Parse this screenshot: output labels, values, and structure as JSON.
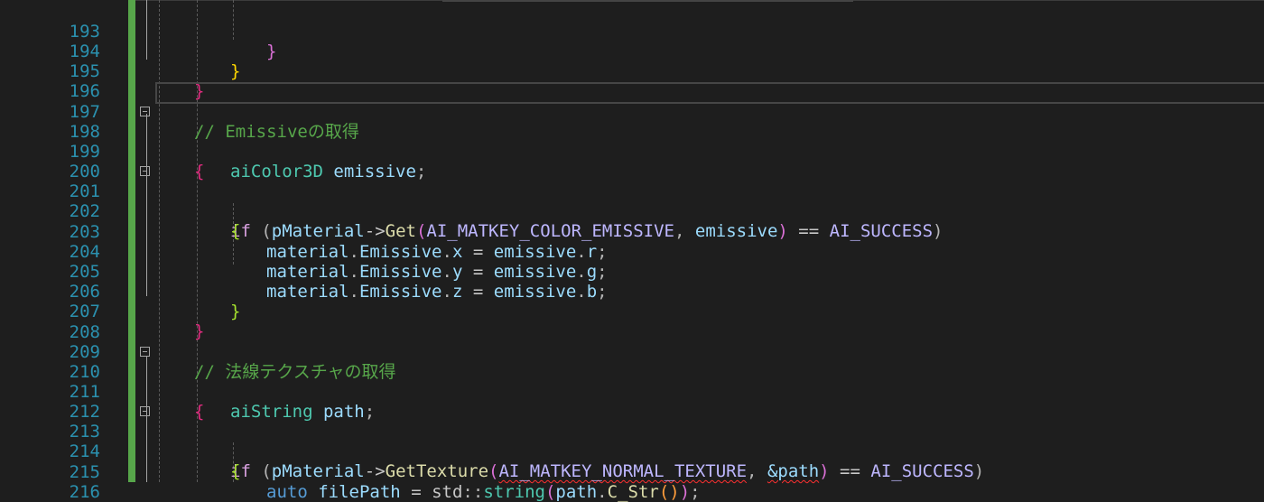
{
  "editor": {
    "line_numbers": [
      "193",
      "194",
      "195",
      "196",
      "197",
      "198",
      "199",
      "200",
      "201",
      "202",
      "203",
      "204",
      "205",
      "206",
      "207",
      "208",
      "209",
      "210",
      "211",
      "212",
      "213",
      "214",
      "215",
      "216"
    ],
    "lines": {
      "l193": {
        "close": "}"
      },
      "l194": {
        "close": "}"
      },
      "l195": {
        "close": "}"
      },
      "l197": {
        "comment": "// Emissiveの取得"
      },
      "l198": {
        "open": "{"
      },
      "l199": {
        "type": "aiColor3D",
        "name": "emissive",
        "semi": ";"
      },
      "l201": {
        "kw": "if",
        "p1": "(",
        "obj": "pMaterial",
        "arrow": "->",
        "fn": "Get",
        "p2": "(",
        "macro": "AI_MATKEY_COLOR_EMISSIVE",
        "comma": ",",
        "arg": "emissive",
        "p3": ")",
        "op": "==",
        "rhs": "AI_SUCCESS",
        "p4": ")"
      },
      "l202": {
        "open": "{"
      },
      "l203": {
        "obj": "material",
        "dot1": ".",
        "field": "Emissive",
        "dot2": ".",
        "comp": "x",
        "eq": "=",
        "rhs": "emissive",
        "dot3": ".",
        "rcomp": "r",
        "semi": ";"
      },
      "l204": {
        "obj": "material",
        "dot1": ".",
        "field": "Emissive",
        "dot2": ".",
        "comp": "y",
        "eq": "=",
        "rhs": "emissive",
        "dot3": ".",
        "rcomp": "g",
        "semi": ";"
      },
      "l205": {
        "obj": "material",
        "dot1": ".",
        "field": "Emissive",
        "dot2": ".",
        "comp": "z",
        "eq": "=",
        "rhs": "emissive",
        "dot3": ".",
        "rcomp": "b",
        "semi": ";"
      },
      "l206": {
        "close": "}"
      },
      "l207": {
        "close": "}"
      },
      "l209": {
        "comment": "// 法線テクスチャの取得"
      },
      "l210": {
        "open": "{"
      },
      "l211": {
        "type": "aiString",
        "name": "path",
        "semi": ";"
      },
      "l213": {
        "kw": "if",
        "p1": "(",
        "obj": "pMaterial",
        "arrow": "->",
        "fn": "GetTexture",
        "p2": "(",
        "macro": "AI_MATKEY_NORMAL_TEXTURE",
        "comma": ",",
        "arg": "&path",
        "p3": ")",
        "op": "==",
        "rhs": "AI_SUCCESS",
        "p4": ")"
      },
      "l214": {
        "open": "{"
      },
      "l215": {
        "kw": "auto",
        "name": "filePath",
        "eq": "=",
        "ns": "std",
        "scope": "::",
        "fn": "string",
        "p1": "(",
        "obj": "path",
        "dot": ".",
        "method": "C_Str",
        "p2": "()",
        "p3": ")",
        "semi": ";"
      }
    },
    "colors": {
      "background": "#1e1e1e",
      "line_number": "#2b91af",
      "change_bar": "#57a64a",
      "comment": "#57a64a",
      "keyword": "#569cd6"
    }
  }
}
